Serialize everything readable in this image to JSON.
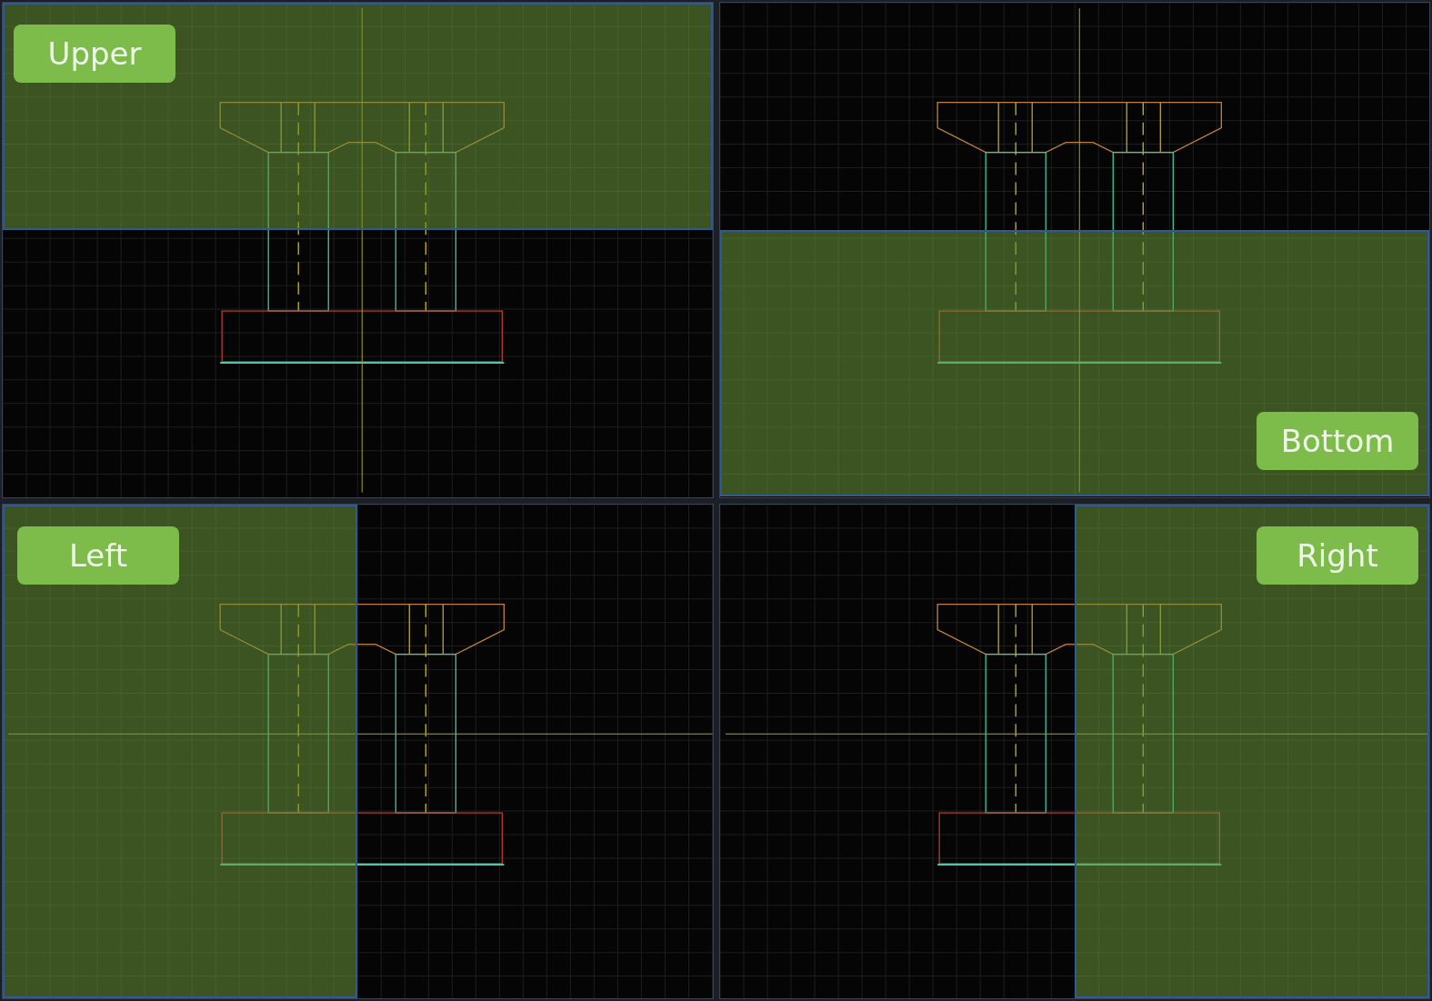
{
  "viewports": [
    {
      "label": "Upper",
      "kind": "upper"
    },
    {
      "label": "Bottom",
      "kind": "bottom"
    },
    {
      "label": "Left",
      "kind": "left"
    },
    {
      "label": "Right",
      "kind": "right"
    }
  ]
}
